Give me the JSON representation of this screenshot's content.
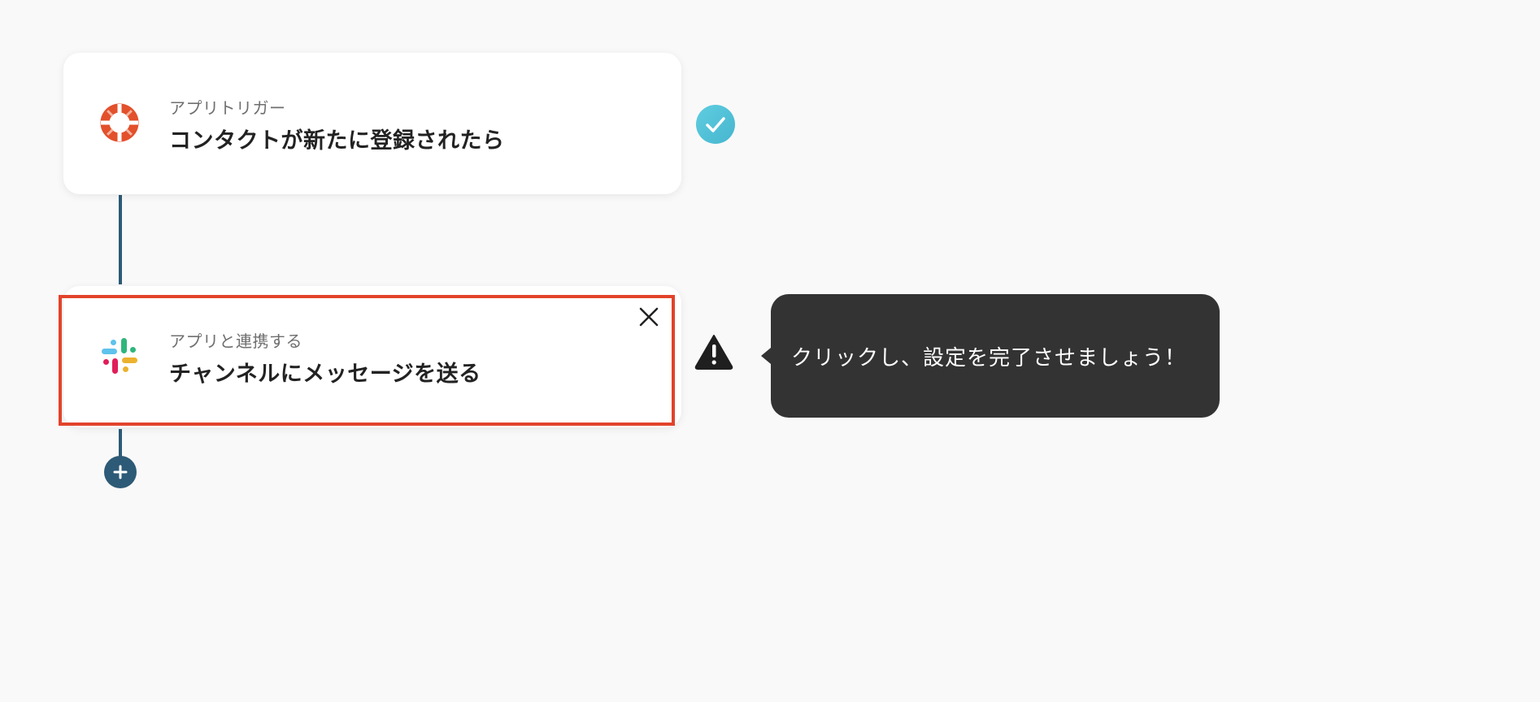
{
  "flow": {
    "trigger": {
      "category": "アプリトリガー",
      "title": "コンタクトが新たに登録されたら",
      "app_icon": "lifebuoy-icon",
      "status": "complete"
    },
    "action": {
      "category": "アプリと連携する",
      "title": "チャンネルにメッセージを送る",
      "app_icon": "slack-icon",
      "status": "incomplete"
    }
  },
  "tooltip": {
    "message": "クリックし、設定を完了させましょう！"
  },
  "icons": {
    "check": "check-icon",
    "warning": "warning-icon",
    "close": "close-icon",
    "add": "plus-icon"
  },
  "colors": {
    "highlight_border": "#e2432b",
    "connector": "#2d5a76",
    "check_badge": "#4fc1d8",
    "tooltip_bg": "#333333",
    "trigger_icon": "#e3502c"
  }
}
